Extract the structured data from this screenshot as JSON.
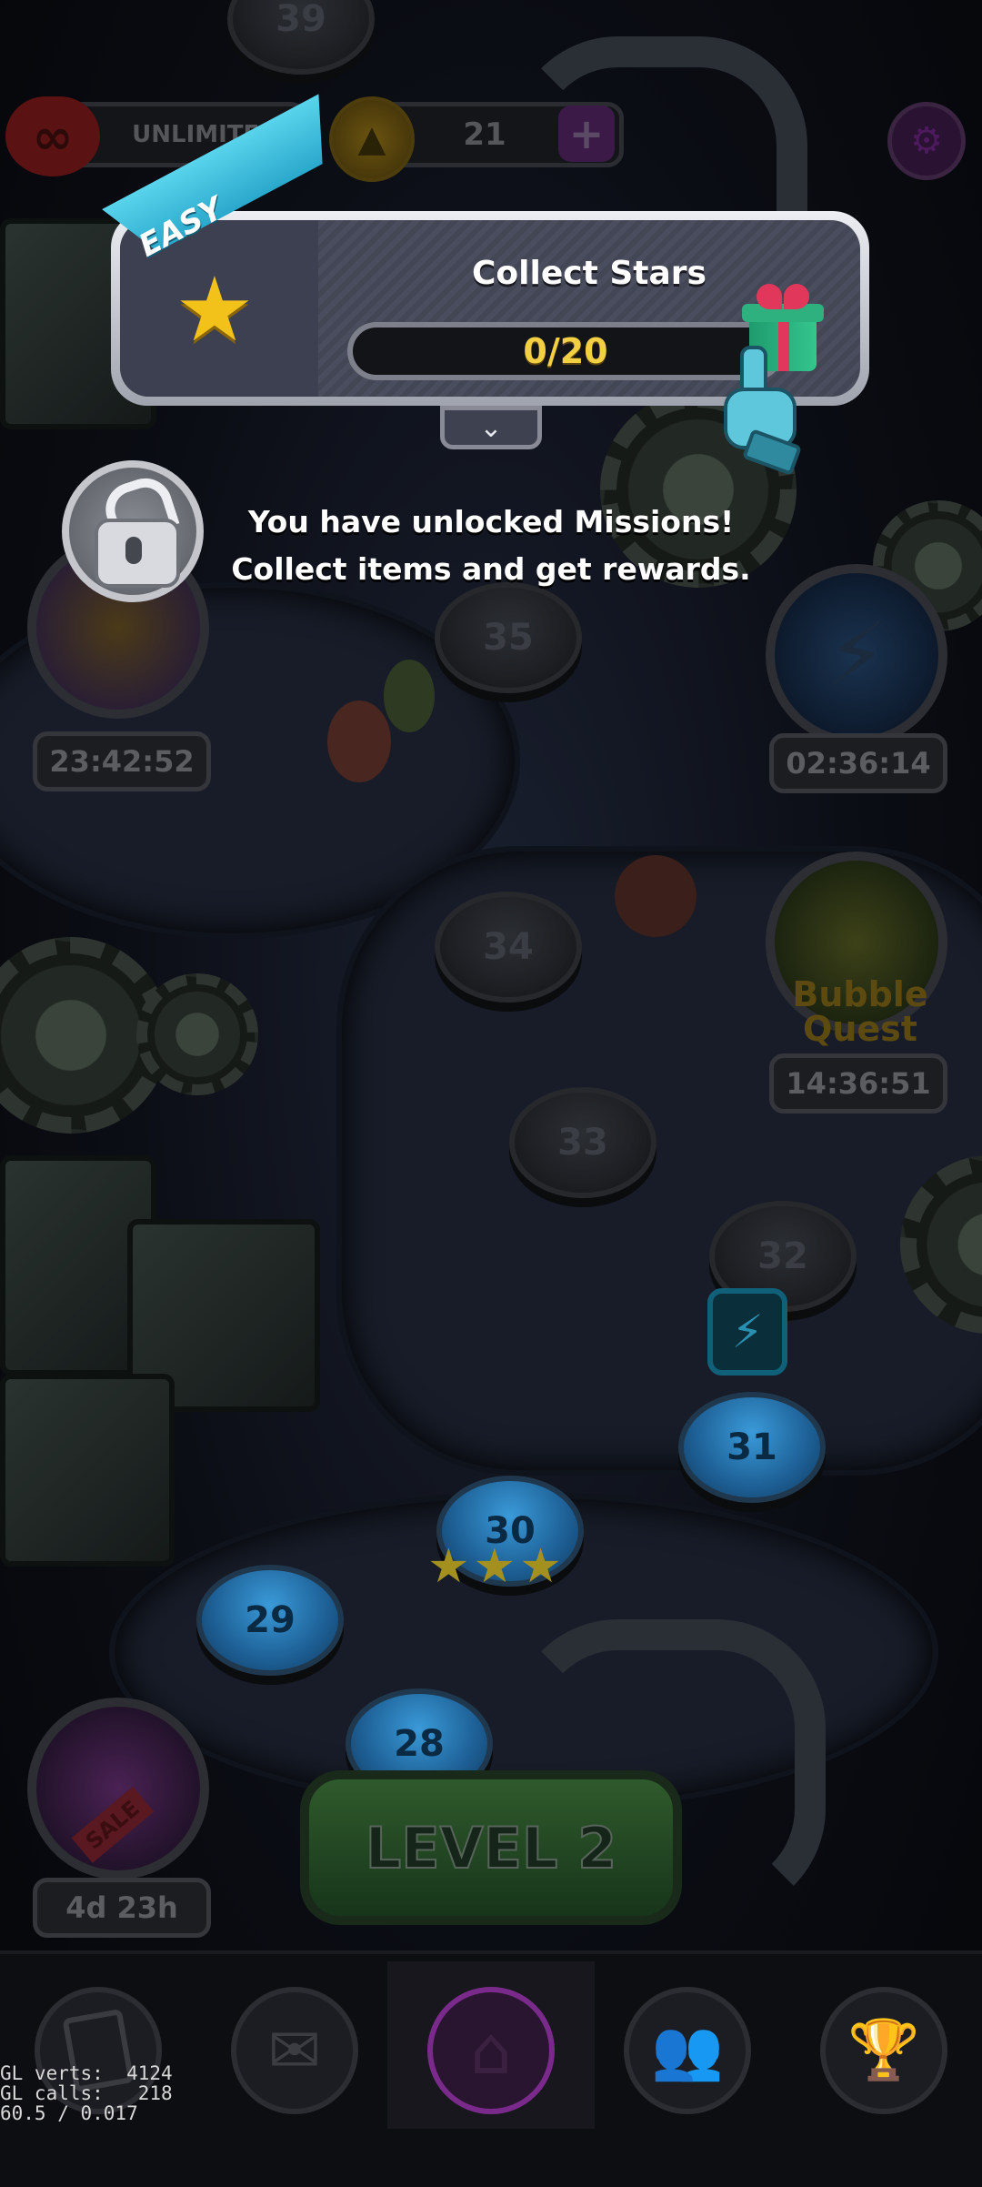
{
  "hud": {
    "lives_label": "UNLIMITED",
    "coins_value": "21",
    "add_symbol": "+"
  },
  "mission": {
    "difficulty": "EASY",
    "title": "Collect Stars",
    "progress_text": "0/20",
    "progress_fraction": 0.0
  },
  "message": {
    "line1": "You have unlocked Missions!",
    "line2": "Collect items and get rewards."
  },
  "events": {
    "left_top_timer": "23:42:52",
    "right_top_timer": "02:36:14",
    "bubble_quest_label": "Bubble Quest",
    "bubble_quest_timer": "14:36:51",
    "sale_label": "SALE",
    "sale_timer": "4d 23h"
  },
  "map": {
    "levels": [
      "39",
      "35",
      "34",
      "33",
      "32",
      "31",
      "30",
      "29",
      "28"
    ],
    "completed_levels": [
      "31",
      "30",
      "29",
      "28"
    ],
    "level_30_stars": 3
  },
  "play_button": {
    "label": "LEVEL 2"
  },
  "nav": {
    "items": [
      "cards",
      "mail",
      "home",
      "friends",
      "trophy"
    ],
    "active": "home"
  },
  "debug": {
    "line1": "GL verts:  4124",
    "line2": "GL calls:   218",
    "line3": "60.5 / 0.017"
  },
  "colors": {
    "accent_blue": "#2aa8cc",
    "progress_text": "#f3cf43",
    "star_gold": "#f2c21a",
    "home_purple": "#7a2a8a"
  }
}
